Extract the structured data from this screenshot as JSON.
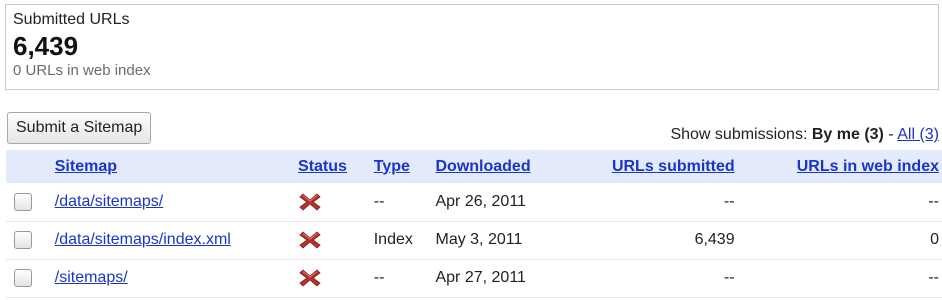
{
  "summary": {
    "title": "Submitted URLs",
    "count": "6,439",
    "index_text": "0 URLs in web index"
  },
  "actions": {
    "submit_label": "Submit a Sitemap"
  },
  "filter": {
    "prefix": "Show submissions: ",
    "by_me": "By me (3)",
    "separator": " - ",
    "all": "All (3)"
  },
  "table": {
    "headers": {
      "sitemap": "Sitemap",
      "status": "Status",
      "type": "Type",
      "downloaded": "Downloaded",
      "urls_submitted": "URLs submitted",
      "urls_indexed": "URLs in web index"
    },
    "rows": [
      {
        "sitemap": "/data/sitemaps/",
        "status_icon": "error-x-icon",
        "type": "--",
        "downloaded": "Apr 26, 2011",
        "urls_submitted": "--",
        "urls_indexed": "--"
      },
      {
        "sitemap": "/data/sitemaps/index.xml",
        "status_icon": "error-x-icon",
        "type": "Index",
        "downloaded": "May 3, 2011",
        "urls_submitted": "6,439",
        "urls_indexed": "0"
      },
      {
        "sitemap": "/sitemaps/",
        "status_icon": "error-x-icon",
        "type": "--",
        "downloaded": "Apr 27, 2011",
        "urls_submitted": "--",
        "urls_indexed": "--"
      }
    ]
  },
  "colors": {
    "link": "#1a35c8",
    "header_bg": "#e3ebfa",
    "error": "#b8302a"
  }
}
